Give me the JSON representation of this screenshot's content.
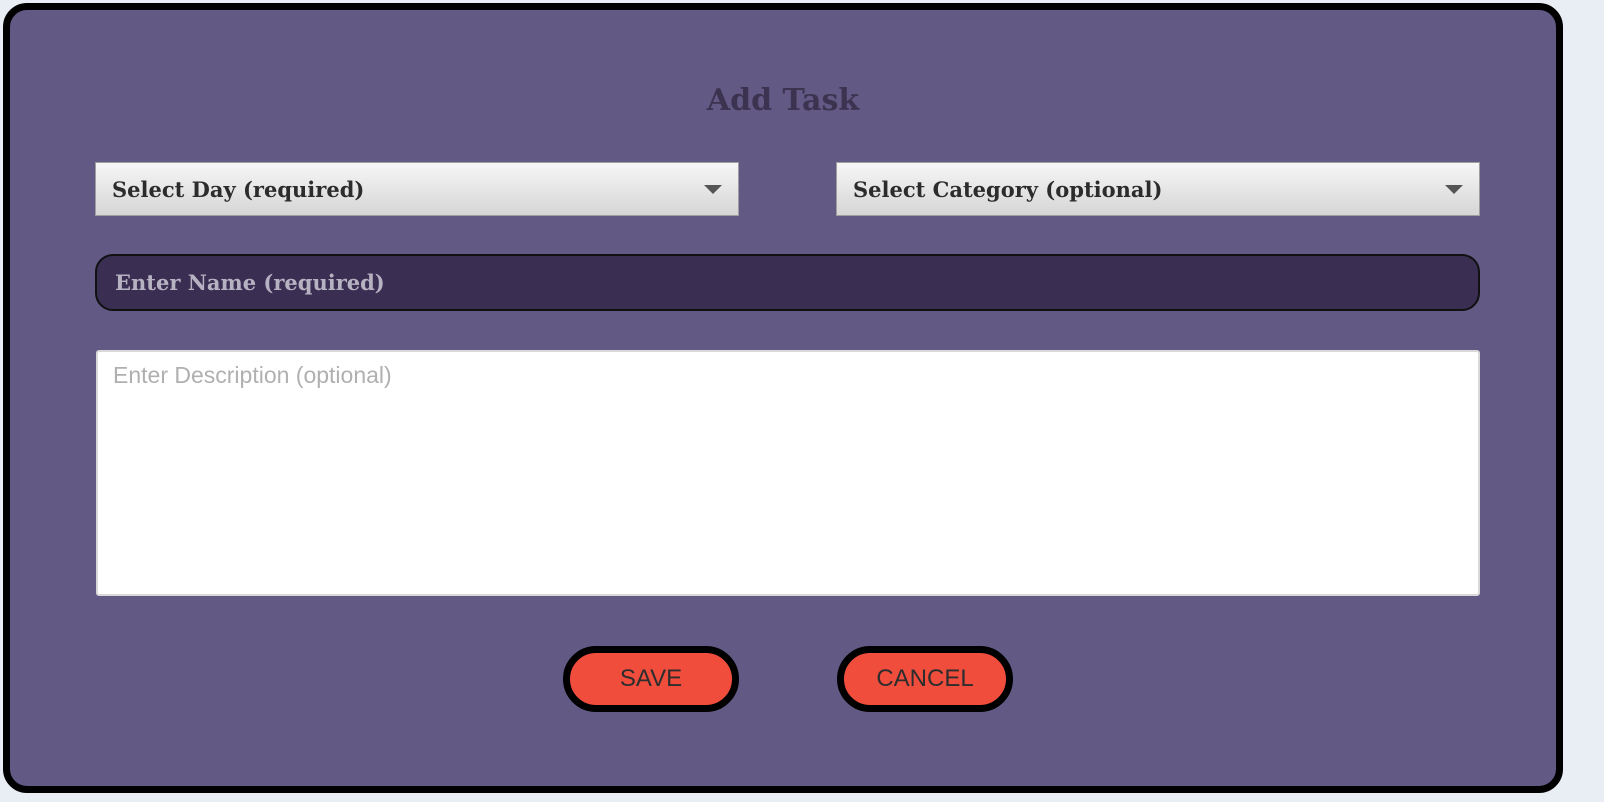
{
  "dialog": {
    "title": "Add Task",
    "day_select": {
      "label": "Select Day (required)"
    },
    "category_select": {
      "label": "Select Category (optional)"
    },
    "name_input": {
      "placeholder": "Enter Name (required)",
      "value": ""
    },
    "description_input": {
      "placeholder": "Enter Description (optional)",
      "value": ""
    },
    "save_label": "SAVE",
    "cancel_label": "CANCEL"
  },
  "colors": {
    "background": "#625984",
    "name_field": "#3a2f53",
    "button": "#f04d3d"
  },
  "icons": [
    "dropdown-caret-icon"
  ]
}
